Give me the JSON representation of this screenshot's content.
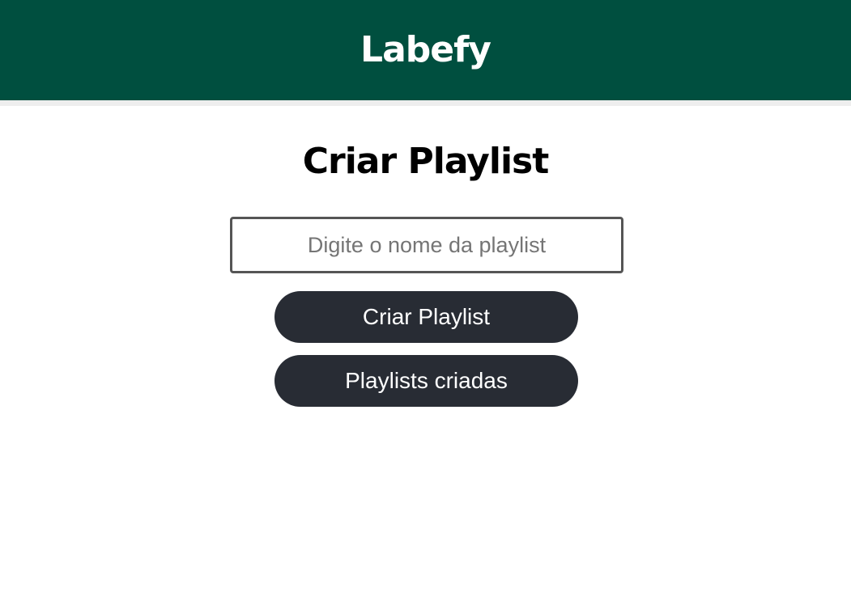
{
  "header": {
    "title": "Labefy"
  },
  "main": {
    "title": "Criar Playlist",
    "playlist_input": {
      "value": "",
      "placeholder": "Digite o nome da playlist"
    },
    "create_button_label": "Criar Playlist",
    "list_button_label": "Playlists criadas"
  },
  "colors": {
    "header_bg": "#004f3f",
    "button_bg": "#282c34",
    "button_text": "#ffffff"
  }
}
